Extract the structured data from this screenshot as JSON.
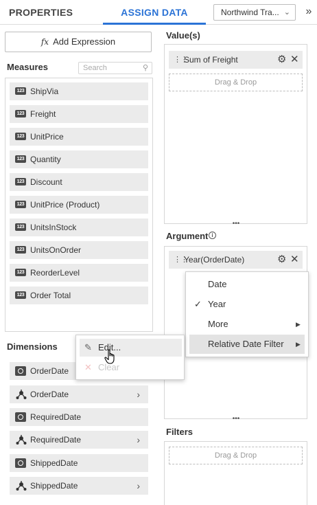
{
  "header": {
    "tab_properties": "PROPERTIES",
    "tab_assign_data": "ASSIGN DATA",
    "datasource_selected": "Northwind Tra...",
    "expand_icon": "double-chevron-right-icon"
  },
  "left": {
    "add_expression_icon": "fx",
    "add_expression_label": "Add Expression",
    "measures_title": "Measures",
    "search_placeholder": "Search",
    "measures": [
      {
        "badge": "123",
        "label": "ShipVia"
      },
      {
        "badge": "123",
        "label": "Freight"
      },
      {
        "badge": "123",
        "label": "UnitPrice"
      },
      {
        "badge": "123",
        "label": "Quantity"
      },
      {
        "badge": "123",
        "label": "Discount"
      },
      {
        "badge": "123",
        "label": "UnitPrice (Product)"
      },
      {
        "badge": "123",
        "label": "UnitsInStock"
      },
      {
        "badge": "123",
        "label": "UnitsOnOrder"
      },
      {
        "badge": "123",
        "label": "ReorderLevel"
      },
      {
        "badge": "123",
        "label": "Order Total"
      }
    ],
    "dimensions_title": "Dimensions",
    "dimensions": [
      {
        "icon": "clock-icon",
        "label": "OrderDate",
        "expandable": false
      },
      {
        "icon": "hierarchy-icon",
        "label": "OrderDate",
        "expandable": true
      },
      {
        "icon": "clock-icon",
        "label": "RequiredDate",
        "expandable": false
      },
      {
        "icon": "hierarchy-icon",
        "label": "RequiredDate",
        "expandable": true
      },
      {
        "icon": "clock-icon",
        "label": "ShippedDate",
        "expandable": false
      },
      {
        "icon": "hierarchy-icon",
        "label": "ShippedDate",
        "expandable": true
      }
    ]
  },
  "right": {
    "values_title": "Value(s)",
    "values_item": "Sum of Freight",
    "drag_drop": "Drag & Drop",
    "argument_title": "Argument",
    "argument_item": "Year(OrderDate)",
    "filters_title": "Filters",
    "filters_drag_drop": "Drag & Drop"
  },
  "date_menu": {
    "items": [
      {
        "label": "Date",
        "checked": false,
        "submenu": false
      },
      {
        "label": "Year",
        "checked": true,
        "submenu": false
      },
      {
        "label": "More",
        "checked": false,
        "submenu": true
      },
      {
        "label": "Relative Date Filter",
        "checked": false,
        "submenu": true
      }
    ],
    "highlighted": "Relative Date Filter"
  },
  "edit_menu": {
    "edit_label": "Edit...",
    "clear_label": "Clear"
  },
  "colors": {
    "accent": "#2b73d6",
    "field_bg": "#ebebeb",
    "border": "#d6d6d6"
  }
}
